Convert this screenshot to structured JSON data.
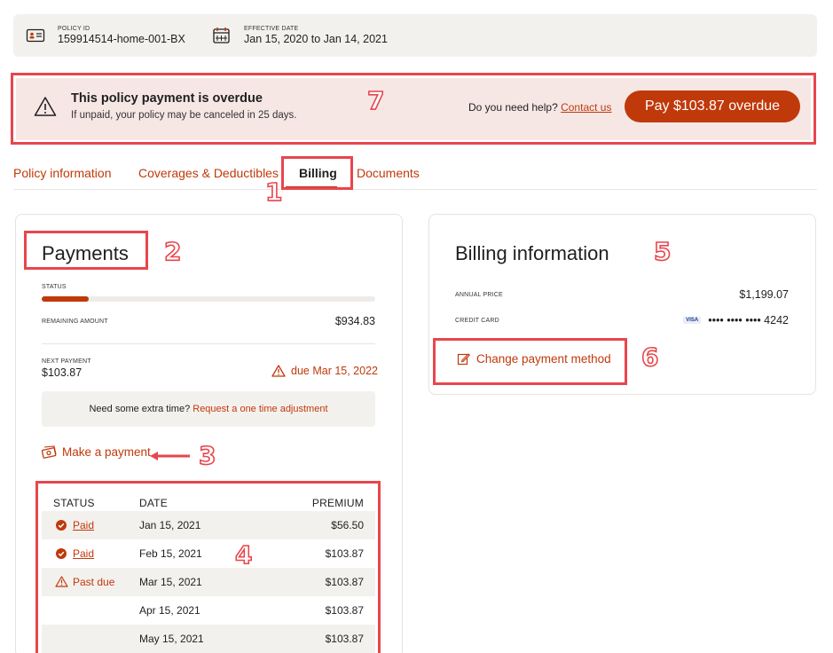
{
  "policy": {
    "id_label": "POLICY ID",
    "id_value": "159914514-home-001-BX",
    "date_label": "EFFECTIVE DATE",
    "date_value": "Jan 15, 2020 to Jan 14, 2021"
  },
  "banner": {
    "title": "This policy payment is overdue",
    "subtitle": "If unpaid, your policy may be canceled in 25 days.",
    "help_text": "Do you need help?",
    "help_link": "Contact us",
    "pay_button": "Pay $103.87 overdue"
  },
  "tabs": [
    {
      "label": "Policy information",
      "active": false
    },
    {
      "label": "Coverages & Deductibles",
      "active": false
    },
    {
      "label": "Billing",
      "active": true
    },
    {
      "label": "Documents",
      "active": false
    }
  ],
  "payments": {
    "title": "Payments",
    "status_label": "STATUS",
    "progress_fraction": 0.14,
    "remaining_label": "REMAINING AMOUNT",
    "remaining_value": "$934.83",
    "next_label": "NEXT PAYMENT",
    "next_value": "$103.87",
    "due_text": "due Mar 15, 2022",
    "extra_text": "Need some extra time?",
    "extra_link": "Request a one time adjustment",
    "make_payment": "Make a payment",
    "table": {
      "headers": [
        "STATUS",
        "DATE",
        "PREMIUM"
      ],
      "rows": [
        {
          "status": "Paid",
          "date": "Jan 15, 2021",
          "premium": "$56.50"
        },
        {
          "status": "Paid",
          "date": "Feb 15, 2021",
          "premium": "$103.87"
        },
        {
          "status": "Past due",
          "date": "Mar 15, 2021",
          "premium": "$103.87"
        },
        {
          "status": "",
          "date": "Apr 15, 2021",
          "premium": "$103.87"
        },
        {
          "status": "",
          "date": "May 15, 2021",
          "premium": "$103.87"
        }
      ]
    }
  },
  "billing": {
    "title": "Billing information",
    "annual_label": "ANNUAL PRICE",
    "annual_value": "$1,199.07",
    "card_label": "CREDIT CARD",
    "card_brand": "VISA",
    "card_number": "•••• •••• •••• 4242",
    "change_method": "Change payment method"
  },
  "annotations": [
    "1",
    "2",
    "3",
    "4",
    "5",
    "6",
    "7"
  ],
  "colors": {
    "accent": "#c0390b",
    "annotation": "#e8464d",
    "banner_bg": "#f6e7e5"
  },
  "icons": [
    "id-card-icon",
    "calendar-icon",
    "warning-icon",
    "check-circle-icon",
    "edit-icon",
    "money-icon",
    "visa-icon"
  ]
}
